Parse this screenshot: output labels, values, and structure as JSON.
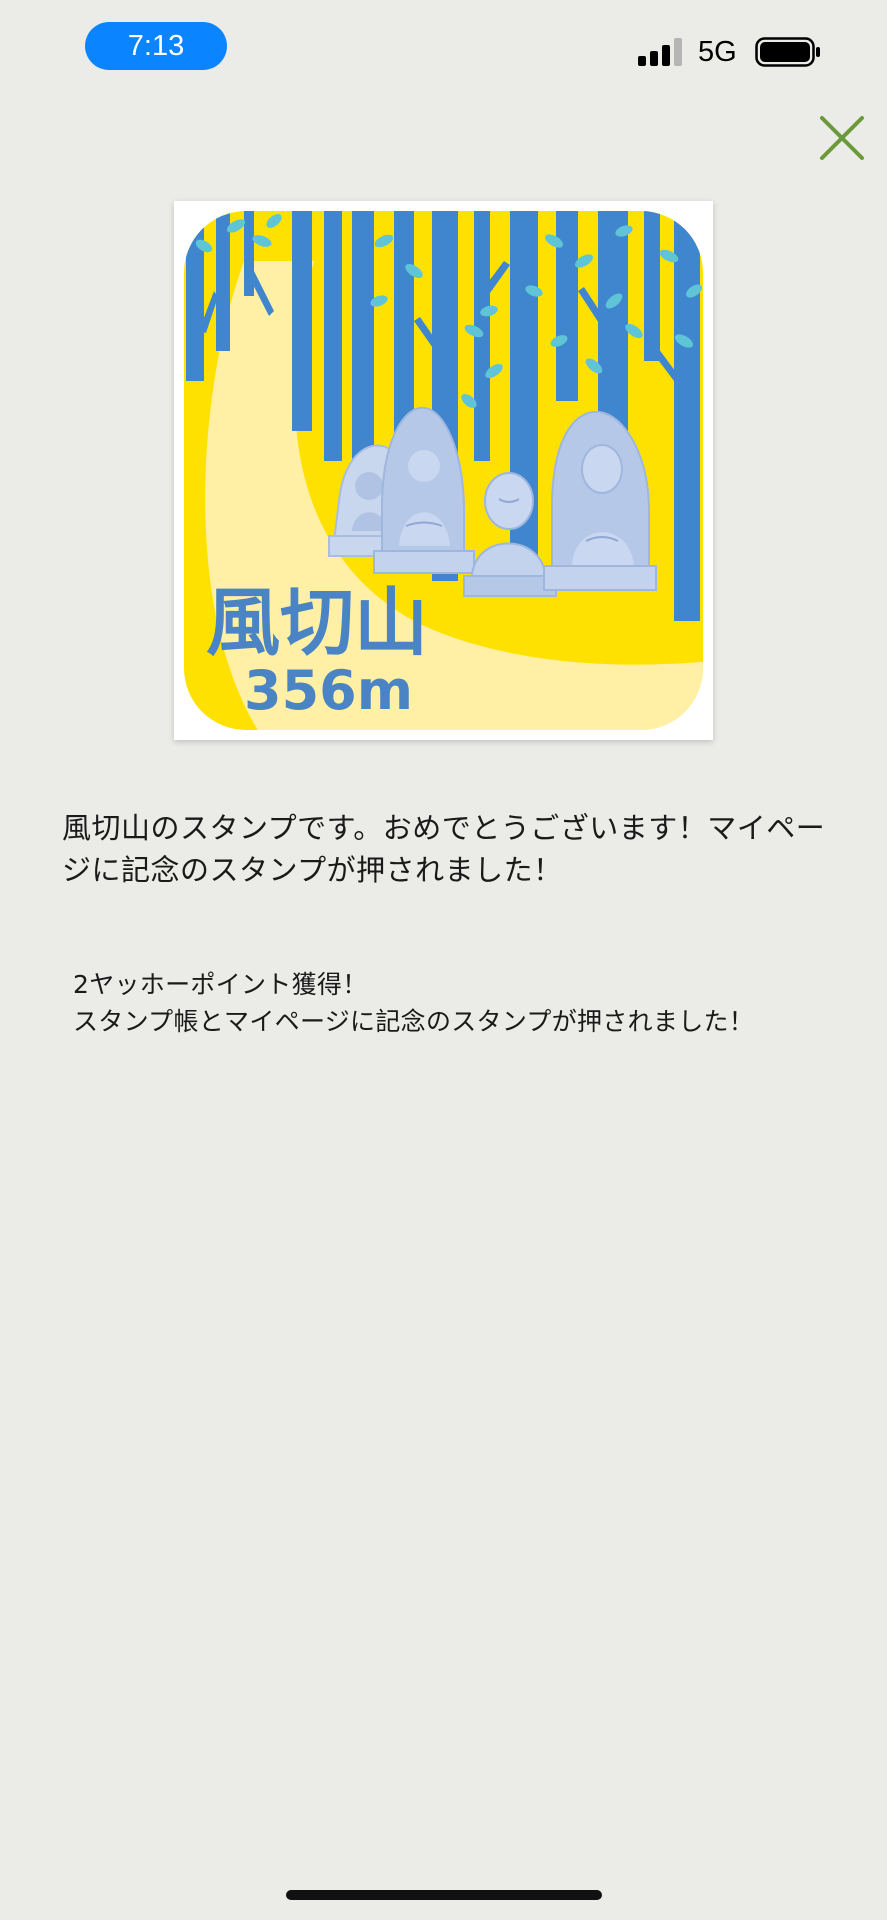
{
  "status_bar": {
    "time": "7:13",
    "network": "5G",
    "signal_icon": "cellular-signal-icon",
    "battery_icon": "battery-icon"
  },
  "close_icon": "close-x-icon",
  "stamp": {
    "name": "風切山",
    "elevation": "356m",
    "colors": {
      "background": "#ffe100",
      "path": "#fff0a6",
      "trees": "#3f86cf",
      "leaves": "#5fc5d6",
      "statues": "#b5c8e8",
      "text": "#4a84c4"
    }
  },
  "message": "風切山のスタンプです。おめでとうございます！マイページに記念のスタンプが押されました！",
  "reward": {
    "line1": "2ヤッホーポイント獲得！",
    "line2": "スタンプ帳とマイページに記念のスタンプが押されました！"
  },
  "colors": {
    "accent": "#0a84ff",
    "close": "#6a9a3a",
    "background": "#ebebe7"
  }
}
